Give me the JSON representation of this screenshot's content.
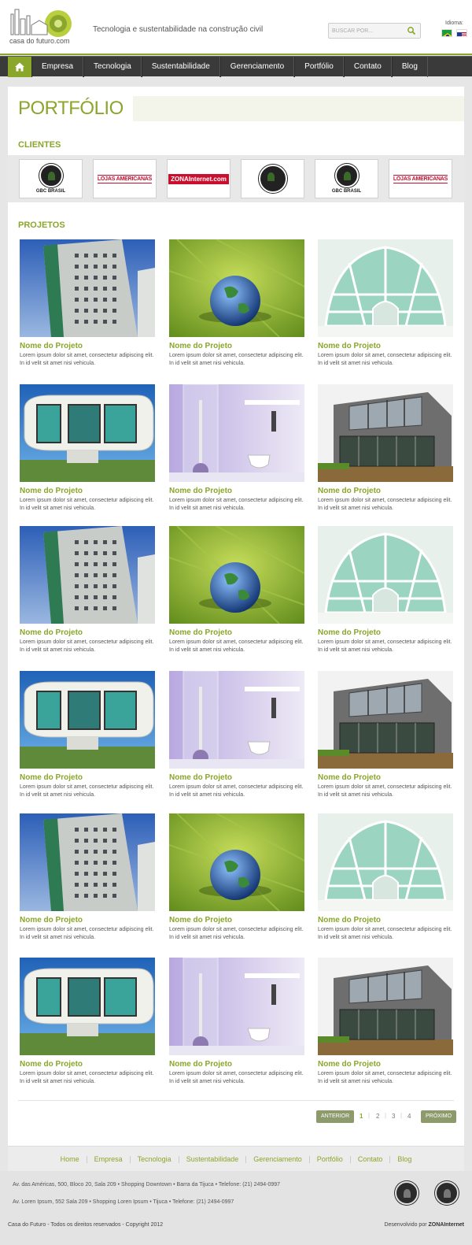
{
  "header": {
    "logo_text": "casa do futuro.com",
    "tagline": "Tecnologia e sustentabilidade na construção civil",
    "search_placeholder": "BUSCAR POR...",
    "language_label": "Idioma:"
  },
  "nav": {
    "items": [
      "Empresa",
      "Tecnologia",
      "Sustentabilidade",
      "Gerenciamento",
      "Portfólio",
      "Contato",
      "Blog"
    ]
  },
  "page": {
    "title": "PORTFÓLIO",
    "clients_title": "CLIENTES",
    "projects_title": "PROJETOS"
  },
  "clients": [
    {
      "type": "gbc",
      "label": "GBC BRASIL"
    },
    {
      "type": "lojas",
      "label": "LOJAS AMERICANAS"
    },
    {
      "type": "zona",
      "label": "ZONAInternet.com"
    },
    {
      "type": "usgbc",
      "label": ""
    },
    {
      "type": "gbc",
      "label": "GBC BRASIL"
    },
    {
      "type": "lojas",
      "label": "LOJAS AMERICANAS"
    }
  ],
  "project_template": {
    "name": "Nome do Projeto",
    "description": "Lorem ipsum dolor sit amet, consectetur adipiscing elit. In id velit sit amet nisi vehicula."
  },
  "projects": [
    {
      "image": "building",
      "name": "Nome do Projeto",
      "description": "Lorem ipsum dolor sit amet, consectetur adipiscing elit. In id velit sit amet nisi vehicula."
    },
    {
      "image": "leaf-globe",
      "name": "Nome do Projeto",
      "description": "Lorem ipsum dolor sit amet, consectetur adipiscing elit. In id velit sit amet nisi vehicula."
    },
    {
      "image": "glass-dome",
      "name": "Nome do Projeto",
      "description": "Lorem ipsum dolor sit amet, consectetur adipiscing elit. In id velit sit amet nisi vehicula."
    },
    {
      "image": "white-house",
      "name": "Nome do Projeto",
      "description": "Lorem ipsum dolor sit amet, consectetur adipiscing elit. In id velit sit amet nisi vehicula."
    },
    {
      "image": "bathroom",
      "name": "Nome do Projeto",
      "description": "Lorem ipsum dolor sit amet, consectetur adipiscing elit. In id velit sit amet nisi vehicula."
    },
    {
      "image": "modern-house",
      "name": "Nome do Projeto",
      "description": "Lorem ipsum dolor sit amet, consectetur adipiscing elit. In id velit sit amet nisi vehicula."
    },
    {
      "image": "building",
      "name": "Nome do Projeto",
      "description": "Lorem ipsum dolor sit amet, consectetur adipiscing elit. In id velit sit amet nisi vehicula."
    },
    {
      "image": "leaf-globe",
      "name": "Nome do Projeto",
      "description": "Lorem ipsum dolor sit amet, consectetur adipiscing elit. In id velit sit amet nisi vehicula."
    },
    {
      "image": "glass-dome",
      "name": "Nome do Projeto",
      "description": "Lorem ipsum dolor sit amet, consectetur adipiscing elit. In id velit sit amet nisi vehicula."
    },
    {
      "image": "white-house",
      "name": "Nome do Projeto",
      "description": "Lorem ipsum dolor sit amet, consectetur adipiscing elit. In id velit sit amet nisi vehicula."
    },
    {
      "image": "bathroom",
      "name": "Nome do Projeto",
      "description": "Lorem ipsum dolor sit amet, consectetur adipiscing elit. In id velit sit amet nisi vehicula."
    },
    {
      "image": "modern-house",
      "name": "Nome do Projeto",
      "description": "Lorem ipsum dolor sit amet, consectetur adipiscing elit. In id velit sit amet nisi vehicula."
    },
    {
      "image": "building",
      "name": "Nome do Projeto",
      "description": "Lorem ipsum dolor sit amet, consectetur adipiscing elit. In id velit sit amet nisi vehicula."
    },
    {
      "image": "leaf-globe",
      "name": "Nome do Projeto",
      "description": "Lorem ipsum dolor sit amet, consectetur adipiscing elit. In id velit sit amet nisi vehicula."
    },
    {
      "image": "glass-dome",
      "name": "Nome do Projeto",
      "description": "Lorem ipsum dolor sit amet, consectetur adipiscing elit. In id velit sit amet nisi vehicula."
    },
    {
      "image": "white-house",
      "name": "Nome do Projeto",
      "description": "Lorem ipsum dolor sit amet, consectetur adipiscing elit. In id velit sit amet nisi vehicula."
    },
    {
      "image": "bathroom",
      "name": "Nome do Projeto",
      "description": "Lorem ipsum dolor sit amet, consectetur adipiscing elit. In id velit sit amet nisi vehicula."
    },
    {
      "image": "modern-house",
      "name": "Nome do Projeto",
      "description": "Lorem ipsum dolor sit amet, consectetur adipiscing elit. In id velit sit amet nisi vehicula."
    }
  ],
  "pagination": {
    "prev": "ANTERIOR",
    "next": "PRÓXIMO",
    "pages": [
      "1",
      "2",
      "3",
      "4"
    ],
    "current": "1"
  },
  "footer_nav": [
    "Home",
    "Empresa",
    "Tecnologia",
    "Sustentabilidade",
    "Gerenciamento",
    "Portfólio",
    "Contato",
    "Blog"
  ],
  "footer": {
    "address_1": "Av. das Américas, 500, Bloco 20, Sala 209 • Shopping Downtown • Barra da Tijuca • Telefone: (21) 2494-0997",
    "address_2": "Av. Loren Ipsum, 552 Sala 209 • Shopping Loren Ipsum • Tijuca • Telefone: (21) 2494-0997",
    "copyright": "Casa do Futuro - Todos os direitos reservados - Copyright 2012",
    "developer_prefix": "Desenvolvido por",
    "developer_name": "ZONAInternet"
  },
  "colors": {
    "accent": "#8aa62b",
    "nav_bg": "#3a3a3a",
    "pagination_btn": "#8c9a6c"
  }
}
